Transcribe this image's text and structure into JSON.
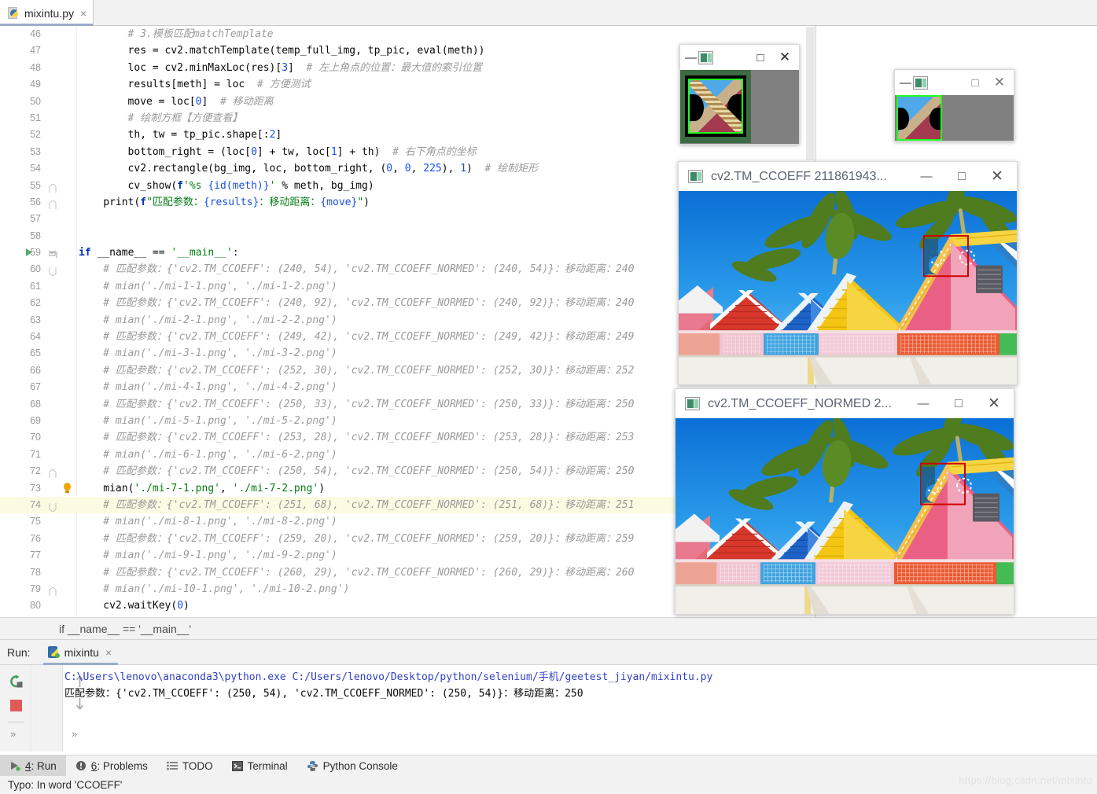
{
  "app": {
    "title": "mixintu.py",
    "tab_close_glyph": "×"
  },
  "editor": {
    "file_tab_label": "mixintu.py",
    "lines": [
      {
        "num": "46",
        "indent": 8,
        "segs": [
          {
            "t": "# 3.模板匹配matchTemplate",
            "c": "c-cmt"
          }
        ]
      },
      {
        "num": "47",
        "indent": 8,
        "segs": [
          {
            "t": "res = cv2.matchTemplate(temp_full_img, tp_pic, ",
            "c": "c-plain"
          },
          {
            "t": "eval",
            "c": "c-plain"
          },
          {
            "t": "(meth))",
            "c": "c-plain"
          }
        ]
      },
      {
        "num": "48",
        "indent": 8,
        "segs": [
          {
            "t": "loc = cv2.minMaxLoc(res)[",
            "c": "c-plain"
          },
          {
            "t": "3",
            "c": "c-num"
          },
          {
            "t": "]  ",
            "c": "c-plain"
          },
          {
            "t": "# 左上角点的位置：最大值的索引位置",
            "c": "c-cmt"
          }
        ]
      },
      {
        "num": "49",
        "indent": 8,
        "segs": [
          {
            "t": "results[meth] = loc  ",
            "c": "c-plain"
          },
          {
            "t": "# 方便测试",
            "c": "c-cmt"
          }
        ]
      },
      {
        "num": "50",
        "indent": 8,
        "segs": [
          {
            "t": "move = loc[",
            "c": "c-plain"
          },
          {
            "t": "0",
            "c": "c-num"
          },
          {
            "t": "]  ",
            "c": "c-plain"
          },
          {
            "t": "# 移动距离",
            "c": "c-cmt"
          }
        ]
      },
      {
        "num": "51",
        "indent": 8,
        "segs": [
          {
            "t": "# 绘制方框【方便查看】",
            "c": "c-cmt"
          }
        ]
      },
      {
        "num": "52",
        "indent": 8,
        "segs": [
          {
            "t": "th, tw = tp_pic.shape[:",
            "c": "c-plain"
          },
          {
            "t": "2",
            "c": "c-num"
          },
          {
            "t": "]",
            "c": "c-plain"
          }
        ]
      },
      {
        "num": "53",
        "indent": 8,
        "segs": [
          {
            "t": "bottom_right = (loc[",
            "c": "c-plain"
          },
          {
            "t": "0",
            "c": "c-num"
          },
          {
            "t": "] + tw, loc[",
            "c": "c-plain"
          },
          {
            "t": "1",
            "c": "c-num"
          },
          {
            "t": "] + th)  ",
            "c": "c-plain"
          },
          {
            "t": "# 右下角点的坐标",
            "c": "c-cmt"
          }
        ]
      },
      {
        "num": "54",
        "indent": 8,
        "segs": [
          {
            "t": "cv2.rectangle(bg_img, loc, bottom_right, (",
            "c": "c-plain"
          },
          {
            "t": "0",
            "c": "c-num"
          },
          {
            "t": ", ",
            "c": "c-plain"
          },
          {
            "t": "0",
            "c": "c-num"
          },
          {
            "t": ", ",
            "c": "c-plain"
          },
          {
            "t": "225",
            "c": "c-num"
          },
          {
            "t": "), ",
            "c": "c-plain"
          },
          {
            "t": "1",
            "c": "c-num"
          },
          {
            "t": ")  ",
            "c": "c-plain"
          },
          {
            "t": "# 绘制矩形",
            "c": "c-cmt"
          }
        ]
      },
      {
        "num": "55",
        "indent": 8,
        "fold": true,
        "segs": [
          {
            "t": "cv_show(",
            "c": "c-plain"
          },
          {
            "t": "f",
            "c": "c-kw"
          },
          {
            "t": "'%s ",
            "c": "c-str"
          },
          {
            "t": "{id(meth)}",
            "c": "c-num"
          },
          {
            "t": "'",
            "c": "c-str"
          },
          {
            "t": " % meth, bg_img)",
            "c": "c-plain"
          }
        ]
      },
      {
        "num": "56",
        "indent": 4,
        "fold": true,
        "segs": [
          {
            "t": "print(",
            "c": "c-plain"
          },
          {
            "t": "f",
            "c": "c-kw"
          },
          {
            "t": "\"匹配参数：",
            "c": "c-str"
          },
          {
            "t": "{results}",
            "c": "c-num"
          },
          {
            "t": "：移动距离：",
            "c": "c-str"
          },
          {
            "t": "{move}",
            "c": "c-num"
          },
          {
            "t": "\"",
            "c": "c-str"
          },
          {
            "t": ")",
            "c": "c-plain"
          }
        ]
      },
      {
        "num": "57",
        "indent": 0,
        "segs": []
      },
      {
        "num": "58",
        "indent": 0,
        "segs": []
      },
      {
        "num": "59",
        "indent": 0,
        "run": true,
        "foldopen": true,
        "segs": [
          {
            "t": "if",
            "c": "c-kw"
          },
          {
            "t": " __name__ == ",
            "c": "c-plain"
          },
          {
            "t": "'__main__'",
            "c": "c-str"
          },
          {
            "t": ":",
            "c": "c-plain"
          }
        ]
      },
      {
        "num": "60",
        "indent": 4,
        "foldopen2": true,
        "segs": [
          {
            "t": "# 匹配参数：{'cv2.TM_CCOEFF': (240, 54), 'cv2.TM_CCOEFF_NORMED': (240, 54)}：移动距离：240",
            "c": "c-cmt"
          }
        ]
      },
      {
        "num": "61",
        "indent": 4,
        "segs": [
          {
            "t": "# mian('./mi-1-1.png', './mi-1-2.png')",
            "c": "c-cmt"
          }
        ]
      },
      {
        "num": "62",
        "indent": 4,
        "segs": [
          {
            "t": "# 匹配参数：{'cv2.TM_CCOEFF': (240, 92), 'cv2.TM_CCOEFF_NORMED': (240, 92)}：移动距离：240",
            "c": "c-cmt"
          }
        ]
      },
      {
        "num": "63",
        "indent": 4,
        "segs": [
          {
            "t": "# mian('./mi-2-1.png', './mi-2-2.png')",
            "c": "c-cmt"
          }
        ]
      },
      {
        "num": "64",
        "indent": 4,
        "segs": [
          {
            "t": "# 匹配参数：{'cv2.TM_CCOEFF': (249, 42), 'cv2.TM_CCOEFF_NORMED': (249, 42)}：移动距离：249",
            "c": "c-cmt"
          }
        ]
      },
      {
        "num": "65",
        "indent": 4,
        "segs": [
          {
            "t": "# mian('./mi-3-1.png', './mi-3-2.png')",
            "c": "c-cmt"
          }
        ]
      },
      {
        "num": "66",
        "indent": 4,
        "segs": [
          {
            "t": "# 匹配参数：{'cv2.TM_CCOEFF': (252, 30), 'cv2.TM_CCOEFF_NORMED': (252, 30)}：移动距离：252",
            "c": "c-cmt"
          }
        ]
      },
      {
        "num": "67",
        "indent": 4,
        "segs": [
          {
            "t": "# mian('./mi-4-1.png', './mi-4-2.png')",
            "c": "c-cmt"
          }
        ]
      },
      {
        "num": "68",
        "indent": 4,
        "segs": [
          {
            "t": "# 匹配参数：{'cv2.TM_CCOEFF': (250, 33), 'cv2.TM_CCOEFF_NORMED': (250, 33)}：移动距离：250",
            "c": "c-cmt"
          }
        ]
      },
      {
        "num": "69",
        "indent": 4,
        "segs": [
          {
            "t": "# mian('./mi-5-1.png', './mi-5-2.png')",
            "c": "c-cmt"
          }
        ]
      },
      {
        "num": "70",
        "indent": 4,
        "segs": [
          {
            "t": "# 匹配参数：{'cv2.TM_CCOEFF': (253, 28), 'cv2.TM_CCOEFF_NORMED': (253, 28)}：移动距离：253",
            "c": "c-cmt"
          }
        ]
      },
      {
        "num": "71",
        "indent": 4,
        "segs": [
          {
            "t": "# mian('./mi-6-1.png', './mi-6-2.png')",
            "c": "c-cmt"
          }
        ]
      },
      {
        "num": "72",
        "indent": 4,
        "fold": true,
        "segs": [
          {
            "t": "# 匹配参数：{'cv2.TM_CCOEFF': (250, 54), 'cv2.TM_CCOEFF_NORMED': (250, 54)}：移动距离：250",
            "c": "c-cmt"
          }
        ]
      },
      {
        "num": "73",
        "indent": 4,
        "bulb": true,
        "segs": [
          {
            "t": "mian(",
            "c": "c-plain"
          },
          {
            "t": "'./mi-7-1.png'",
            "c": "c-str"
          },
          {
            "t": ", ",
            "c": "c-plain"
          },
          {
            "t": "'./mi-7-2.png'",
            "c": "c-str"
          },
          {
            "t": ")",
            "c": "c-plain"
          }
        ]
      },
      {
        "num": "74",
        "indent": 4,
        "hl": true,
        "foldopen2": true,
        "segs": [
          {
            "t": "# 匹配参数：{'cv2.TM_CCOEFF': (251, 68), 'cv2.TM_CCOEFF_NORMED': (251, 68)}：移动距离：251",
            "c": "c-cmt"
          }
        ]
      },
      {
        "num": "75",
        "indent": 4,
        "segs": [
          {
            "t": "# mian('./mi-8-1.png', './mi-8-2.png')",
            "c": "c-cmt"
          }
        ]
      },
      {
        "num": "76",
        "indent": 4,
        "segs": [
          {
            "t": "# 匹配参数：{'cv2.TM_CCOEFF': (259, 20), 'cv2.TM_CCOEFF_NORMED': (259, 20)}：移动距离：259",
            "c": "c-cmt"
          }
        ]
      },
      {
        "num": "77",
        "indent": 4,
        "segs": [
          {
            "t": "# mian('./mi-9-1.png', './mi-9-2.png')",
            "c": "c-cmt"
          }
        ]
      },
      {
        "num": "78",
        "indent": 4,
        "segs": [
          {
            "t": "# 匹配参数：{'cv2.TM_CCOEFF': (260, 29), 'cv2.TM_CCOEFF_NORMED': (260, 29)}：移动距离：260",
            "c": "c-cmt"
          }
        ]
      },
      {
        "num": "79",
        "indent": 4,
        "fold": true,
        "segs": [
          {
            "t": "# mian('./mi-10-1.png', './mi-10-2.png')",
            "c": "c-cmt"
          }
        ]
      },
      {
        "num": "80",
        "indent": 4,
        "segs": [
          {
            "t": "cv2.waitKey(",
            "c": "c-plain"
          },
          {
            "t": "0",
            "c": "c-num"
          },
          {
            "t": ")",
            "c": "c-plain"
          }
        ]
      }
    ]
  },
  "breadcrumb": {
    "text": "if __name__ == '__main__'"
  },
  "run_panel": {
    "run_label": "Run:",
    "tab_label": "mixintu",
    "tab_close_glyph": "×",
    "rerun_tooltip": "Rerun",
    "stop_tooltip": "Stop",
    "chevron_glyph": "»",
    "output_line1_cmd": "C:\\Users\\lenovo\\anaconda3\\python.exe ",
    "output_line1_script": "C:/Users/lenovo/Desktop/python/selenium/手机/geetest_jiyan/mixintu.py",
    "output_line2": "匹配参数：{'cv2.TM_CCOEFF': (250, 54), 'cv2.TM_CCOEFF_NORMED': (250, 54)}：移动距离：250"
  },
  "status_strip": {
    "items": [
      {
        "label_pre": "",
        "key": "4",
        "label": ": Run",
        "icon": "run-icon",
        "active": true
      },
      {
        "label_pre": "",
        "key": "6",
        "label": ": Problems",
        "icon": "problems-icon",
        "active": false
      },
      {
        "label_pre": "",
        "key": "",
        "label": "TODO",
        "icon": "todo-icon",
        "active": false
      },
      {
        "label_pre": "",
        "key": "",
        "label": "Terminal",
        "icon": "terminal-icon",
        "active": false
      },
      {
        "label_pre": "",
        "key": "",
        "label": "Python Console",
        "icon": "python-console-icon",
        "active": false
      }
    ]
  },
  "status_bar": {
    "message": "Typo: In word 'CCOEFF'"
  },
  "watermark": {
    "text": "https://blog.csdn.net/mixintu"
  },
  "cv_windows": [
    {
      "name": "template-window-1",
      "title": "",
      "minimize_glyph": "—",
      "maximize_glyph": "□",
      "close_glyph": "✕",
      "kind": "template-dark-green"
    },
    {
      "name": "template-window-2",
      "title": "",
      "minimize_glyph": "—",
      "maximize_glyph": "□",
      "close_glyph": "✕",
      "kind": "template-plain"
    },
    {
      "name": "match-window-ccoeff",
      "title": "cv2.TM_CCOEFF 211861943...",
      "minimize_glyph": "—",
      "maximize_glyph": "□",
      "close_glyph": "✕",
      "kind": "beach-huts"
    },
    {
      "name": "match-window-ccoeff-normed",
      "title": "cv2.TM_CCOEFF_NORMED 2...",
      "minimize_glyph": "—",
      "maximize_glyph": "□",
      "close_glyph": "✕",
      "kind": "beach-huts"
    }
  ],
  "colors": {
    "accent": "#9aacc8",
    "comment": "#9b9b9b",
    "keyword": "#0033b3",
    "string": "#067d17",
    "number": "#1750eb",
    "match_box": "#d00000",
    "run_green": "#59a869",
    "stop_red": "#e05a5a"
  }
}
